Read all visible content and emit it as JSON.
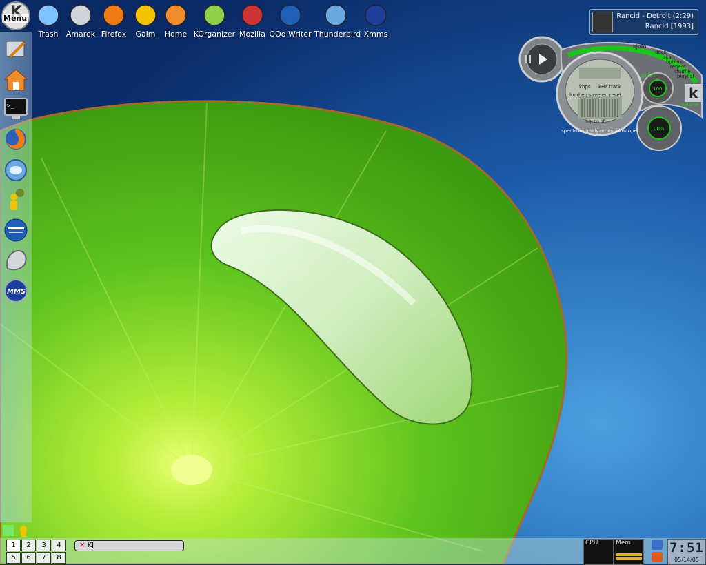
{
  "kmenu": {
    "label": "Menu"
  },
  "desktop_icons": [
    {
      "label": "Trash",
      "icon": "trash-icon"
    },
    {
      "label": "Amarok",
      "icon": "amarok-icon"
    },
    {
      "label": "Firefox",
      "icon": "firefox-icon"
    },
    {
      "label": "Gaim",
      "icon": "gaim-icon"
    },
    {
      "label": "Home",
      "icon": "home-icon"
    },
    {
      "label": "KOrganizer",
      "icon": "korganizer-icon"
    },
    {
      "label": "Mozilla",
      "icon": "mozilla-icon"
    },
    {
      "label": "OOo Writer",
      "icon": "ooo-writer-icon"
    },
    {
      "label": "Thunderbird",
      "icon": "thunderbird-icon"
    },
    {
      "label": "Xmms",
      "icon": "xmms-icon"
    }
  ],
  "left_panel": {
    "launchers": [
      "text-editor-icon",
      "home-icon",
      "terminal-icon",
      "firefox-icon",
      "thunderbird-icon",
      "gaim-icon",
      "ooo-writer-icon",
      "amarok-icon",
      "xmms-icon"
    ]
  },
  "now_playing": {
    "line1": "Rancid - Detroit (2:29)",
    "line2": "Rancid [1993]"
  },
  "kjofol": {
    "brand": "kjofol",
    "menu": [
      "dock",
      "scan",
      "options",
      "repeat",
      "shuffle",
      "playlist"
    ],
    "kbps": "kbps",
    "khz": "kHz track",
    "eq_row": "load eq  save eq  reset",
    "eq_state": "eq: on  off",
    "pitch_label": "pitch",
    "pitch_value": "100",
    "volume_label": "volume",
    "volume_value": "00%",
    "bottom_label": "spectrum analyzer  oscilloscope",
    "logo": "k"
  },
  "pager": {
    "desktops": [
      "1",
      "2",
      "3",
      "4",
      "5",
      "6",
      "7",
      "8"
    ],
    "active": "1"
  },
  "taskbar": {
    "task_label": "KJ"
  },
  "monitors": {
    "cpu_label": "CPU",
    "mem_label": "Mem"
  },
  "clock": {
    "time": "7:51",
    "date": "05/14/05"
  },
  "colors": {
    "leaf": "#5cc21e",
    "sky": "#0d3a7a",
    "panel": "#c7dde6"
  }
}
